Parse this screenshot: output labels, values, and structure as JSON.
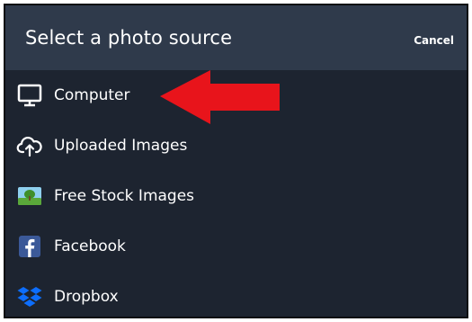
{
  "header": {
    "title": "Select a photo source",
    "cancel_label": "Cancel"
  },
  "sources": [
    {
      "label": "Computer",
      "icon": "monitor-icon"
    },
    {
      "label": "Uploaded Images",
      "icon": "cloud-upload-icon"
    },
    {
      "label": "Free Stock Images",
      "icon": "stock-image-icon"
    },
    {
      "label": "Facebook",
      "icon": "facebook-icon"
    },
    {
      "label": "Dropbox",
      "icon": "dropbox-icon"
    }
  ],
  "colors": {
    "panel_bg": "#1d2430",
    "header_bg": "#2f3a4b",
    "text": "#ffffff",
    "annotation_arrow": "#e8141b",
    "facebook_blue": "#3b5998",
    "dropbox_blue": "#0d6efd"
  }
}
